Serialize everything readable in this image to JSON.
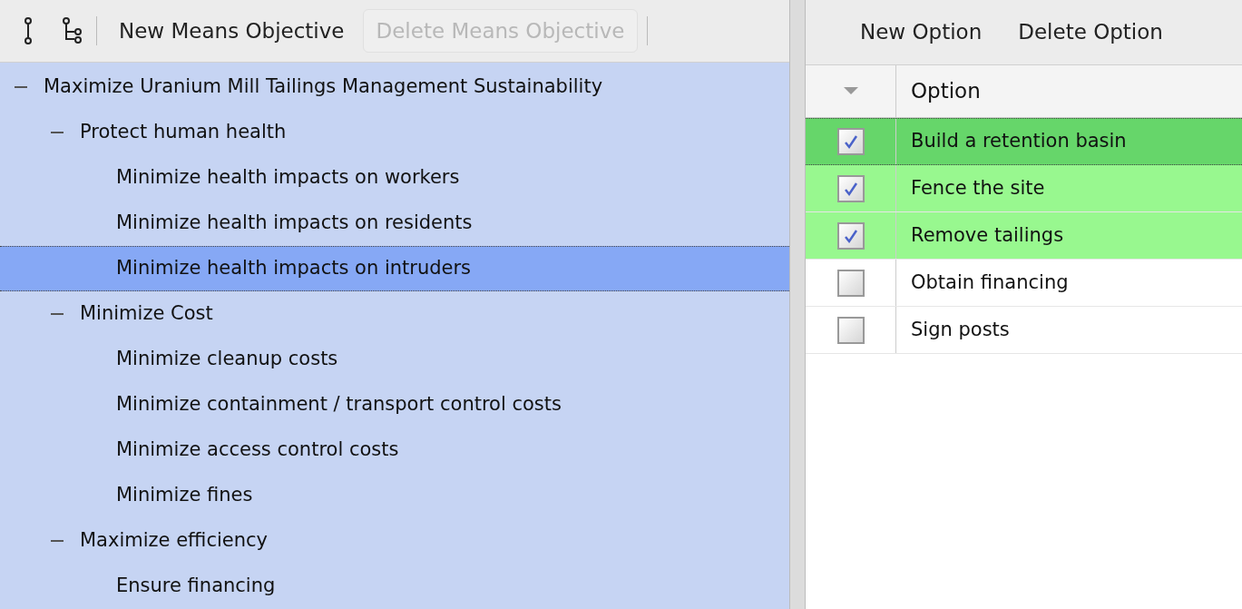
{
  "toolbar": {
    "buttons": [
      {
        "label": "New Means Objective",
        "disabled": false
      },
      {
        "label": "Delete Means Objective",
        "disabled": true
      }
    ]
  },
  "tree": [
    {
      "label": "Maximize Uranium Mill Tailings Management Sustainability",
      "expanded": true,
      "selected": false,
      "children": [
        {
          "label": "Protect human health",
          "expanded": true,
          "selected": false,
          "children": [
            {
              "label": "Minimize health impacts on workers",
              "selected": false
            },
            {
              "label": "Minimize health impacts on residents",
              "selected": false
            },
            {
              "label": "Minimize health impacts on intruders",
              "selected": true
            }
          ]
        },
        {
          "label": "Minimize Cost",
          "expanded": true,
          "selected": false,
          "children": [
            {
              "label": "Minimize cleanup costs",
              "selected": false
            },
            {
              "label": "Minimize containment / transport control costs",
              "selected": false
            },
            {
              "label": "Minimize access control costs",
              "selected": false
            },
            {
              "label": "Minimize fines",
              "selected": false
            }
          ]
        },
        {
          "label": "Maximize efficiency",
          "expanded": true,
          "selected": false,
          "children": [
            {
              "label": "Ensure financing",
              "selected": false
            }
          ]
        }
      ]
    }
  ],
  "options_toolbar": {
    "buttons": [
      "New Option",
      "Delete Option"
    ]
  },
  "options_table": {
    "columns": [
      "Option"
    ],
    "rows": [
      {
        "label": "Build a retention basin",
        "checked": true,
        "selected": true
      },
      {
        "label": "Fence the site",
        "checked": true,
        "selected": false
      },
      {
        "label": "Remove tailings",
        "checked": true,
        "selected": false
      },
      {
        "label": "Obtain financing",
        "checked": false,
        "selected": false
      },
      {
        "label": "Sign posts",
        "checked": false,
        "selected": false
      }
    ]
  }
}
